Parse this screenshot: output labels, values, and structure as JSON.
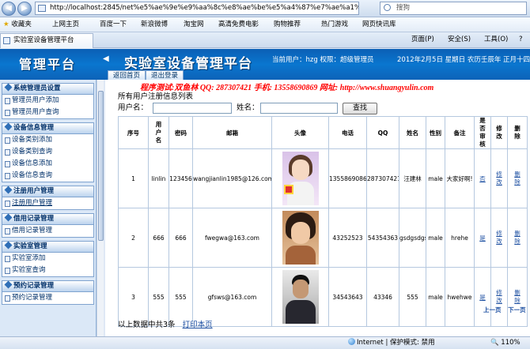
{
  "browser": {
    "url": "http://localhost:2845/net%e5%ae%9e%e9%aa%8c%e8%ae%be%e5%a4%87%e7%ae%a1%e7%",
    "search_placeholder": "搜狗",
    "back_glyph": "◀",
    "forward_glyph": "▶",
    "favorites": [
      {
        "label": "收藏夹"
      },
      {
        "label": "上网主页"
      },
      {
        "label": "百度一下"
      },
      {
        "label": "新浪微博"
      },
      {
        "label": "淘宝网"
      },
      {
        "label": "高清免费电影"
      },
      {
        "label": "购物推荐"
      },
      {
        "label": "热门游戏"
      },
      {
        "label": "网页快讯库"
      }
    ],
    "tab_title": "实验室设备管理平台",
    "commands": {
      "page": "页面(P)",
      "safety": "安全(S)",
      "tools": "工具(O)",
      "help": "?"
    }
  },
  "header": {
    "logo": "管理平台",
    "title": "实验室设备管理平台",
    "user_info": "当前用户：hzg 权限：超级管理员",
    "date_info": "2012年2月5日 星期日 农历壬辰年 正月十四",
    "buttons": {
      "home": "返回首页",
      "logout": "退出登录"
    }
  },
  "sidebar": {
    "groups": [
      {
        "title": "系统管理员设置",
        "items": [
          "管理员用户添加",
          "管理员用户查询"
        ]
      },
      {
        "title": "设备信息管理",
        "items": [
          "设备类别添加",
          "设备类别查询",
          "设备信息添加",
          "设备信息查询"
        ]
      },
      {
        "title": "注册用户管理",
        "items": [
          "注册用户管理"
        ]
      },
      {
        "title": "借用记录管理",
        "items": [
          "借用记录管理"
        ]
      },
      {
        "title": "实验室管理",
        "items": [
          "实验室添加",
          "实验室查询"
        ]
      },
      {
        "title": "预约记录管理",
        "items": [
          "预约记录管理"
        ]
      }
    ]
  },
  "main": {
    "promo": "程序测试:双鱼林  QQ: 287307421  手机: 13558690869  网址: http://www.shuangyulin.com",
    "title": "所有用户注册信息列表",
    "search": {
      "username_label": "用户名：",
      "name_label": "姓名：",
      "find_button": "查找"
    },
    "columns": [
      "序号",
      "用户名",
      "密码",
      "邮箱",
      "头像",
      "电话",
      "QQ",
      "姓名",
      "性别",
      "备注",
      "是否审核",
      "修改",
      "删除"
    ],
    "rows": [
      {
        "index": "1",
        "username": "linlin",
        "password": "123456",
        "email": "wangjianlin1985@126.com",
        "phone": "13558690869",
        "qq": "287307421",
        "name": "汪建林",
        "sex": "male",
        "note": "大家好啊!",
        "approved": "否",
        "edit": "修改",
        "delete": "删除"
      },
      {
        "index": "2",
        "username": "666",
        "password": "666",
        "email": "fwegwa@163.com",
        "phone": "43252523",
        "qq": "54354363",
        "name": "gsdgsdgs",
        "sex": "male",
        "note": "hrehe",
        "approved": "是",
        "edit": "修改",
        "delete": "删除"
      },
      {
        "index": "3",
        "username": "555",
        "password": "555",
        "email": "gfsws@163.com",
        "phone": "34543643",
        "qq": "43346",
        "name": "555",
        "sex": "male",
        "note": "hwehwe",
        "approved": "是",
        "edit": "修改",
        "delete": "删除"
      }
    ],
    "pager": {
      "prev": "上一页",
      "next": "下一页"
    },
    "footer": {
      "summary": "以上数据中共3条",
      "print": "打印本页"
    }
  },
  "statusbar": {
    "zone": "Internet | 保护模式: 禁用",
    "zoom": "110%"
  }
}
